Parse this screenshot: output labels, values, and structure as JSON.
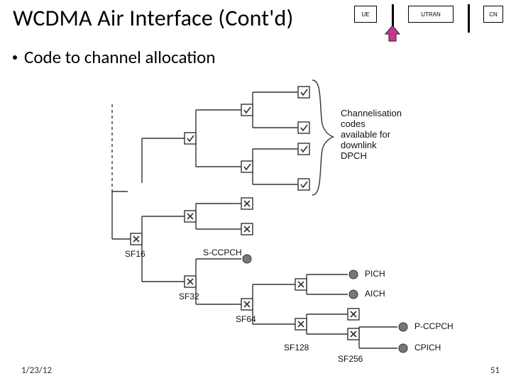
{
  "title": "WCDMA Air Interface (Cont'd)",
  "bullet1": "Code to channel allocation",
  "footer_date": "1/23/12",
  "footer_page": "51",
  "mini": {
    "ue": "UE",
    "utran": "UTRAN",
    "cn": "CN"
  },
  "annotation": {
    "line1": "Channelisation",
    "line2": "codes",
    "line3": "available for",
    "line4": "downlink",
    "line5": "DPCH"
  },
  "sf": {
    "sf16": "SF16",
    "sf32": "SF32",
    "sf64": "SF64",
    "sf128": "SF128",
    "sf256": "SF256"
  },
  "channels": {
    "sccpch": "S-CCPCH",
    "pich": "PICH",
    "aich": "AICH",
    "pccpch": "P-CCPCH",
    "cpich": "CPICH"
  }
}
